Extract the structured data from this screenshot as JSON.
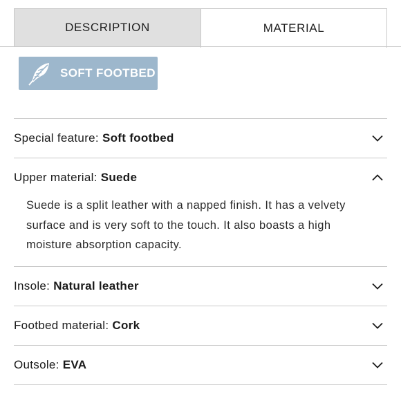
{
  "tabs": [
    {
      "label": "DESCRIPTION",
      "active": false
    },
    {
      "label": "MATERIAL",
      "active": true
    }
  ],
  "badge": {
    "label": "SOFT FOOTBED",
    "icon": "feather-icon",
    "color": "#9db7cc"
  },
  "accordion": [
    {
      "prefix": "Special feature: ",
      "value": "Soft footbed",
      "expanded": false,
      "chevron": "chevron-down-icon"
    },
    {
      "prefix": "Upper material: ",
      "value": "Suede",
      "expanded": true,
      "chevron": "chevron-up-icon",
      "body": "Suede is a split leather with a napped finish. It has a velvety surface and is very soft to the touch. It also boasts a high moisture absorption capacity."
    },
    {
      "prefix": "Insole: ",
      "value": "Natural leather",
      "expanded": false,
      "chevron": "chevron-down-icon"
    },
    {
      "prefix": "Footbed material: ",
      "value": "Cork",
      "expanded": false,
      "chevron": "chevron-down-icon"
    },
    {
      "prefix": "Outsole: ",
      "value": "EVA",
      "expanded": false,
      "chevron": "chevron-down-icon"
    }
  ]
}
